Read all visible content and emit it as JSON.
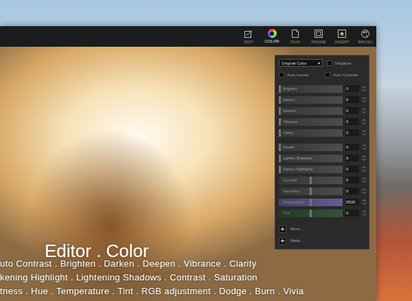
{
  "toolbar": {
    "tabs": [
      {
        "label": "EDIT",
        "selected": false
      },
      {
        "label": "COLOR",
        "selected": true
      },
      {
        "label": "FILM",
        "selected": false
      },
      {
        "label": "FRAME",
        "selected": false
      },
      {
        "label": "INSERT",
        "selected": false
      },
      {
        "label": "BRUSH",
        "selected": false
      }
    ]
  },
  "photo": {
    "title": "Editor . Color",
    "features": [
      "uto Contrast . Brighten . Darken . Deepen . Vibrance . Clarity",
      "kening Highlight . Lightening Shadows . Contrast . Saturation",
      "tness . Hue . Temperature . Tint . RGB adjustment . Dodge . Burn . Vivia"
    ]
  },
  "panel": {
    "preset": {
      "value": "Original Color",
      "arrow": "▾"
    },
    "checkboxes": [
      {
        "label": "Negative",
        "checked": false
      },
      {
        "label": "Auto Levels",
        "checked": false
      },
      {
        "label": "Auto Contrast",
        "checked": false
      }
    ],
    "slider_groups": [
      [
        {
          "label": "Brighten",
          "kind": "slider",
          "level": 0,
          "value": "0"
        },
        {
          "label": "Darken",
          "kind": "slider",
          "level": 0,
          "value": "0"
        },
        {
          "label": "Deepen",
          "kind": "slider",
          "level": 0,
          "value": "0"
        },
        {
          "label": "Vibrance",
          "kind": "slider",
          "level": 0,
          "value": "0"
        },
        {
          "label": "Clarity",
          "kind": "slider",
          "level": 0,
          "value": "0"
        }
      ],
      [
        {
          "label": "Details",
          "kind": "slider",
          "level": 0,
          "value": "0"
        },
        {
          "label": "Lighten Shadows",
          "kind": "slider",
          "level": 0,
          "value": "0"
        },
        {
          "label": "Darken Highlights",
          "kind": "slider",
          "level": 0,
          "value": "0"
        },
        {
          "label": "Contrast",
          "kind": "balance",
          "level": 0.5,
          "value": "0"
        },
        {
          "label": "Saturation",
          "kind": "balance",
          "level": 0.5,
          "value": "0"
        },
        {
          "label": "Temperature",
          "kind": "balance",
          "level": 0.5,
          "value": "6500",
          "color": "#5e5a8c"
        },
        {
          "label": "Tint",
          "kind": "balance",
          "level": 0.5,
          "value": "0",
          "color": "#2f4d35"
        }
      ]
    ],
    "actions": [
      {
        "icon": "+",
        "label": "More..."
      },
      {
        "icon": "+",
        "label": "Mask..."
      }
    ]
  }
}
